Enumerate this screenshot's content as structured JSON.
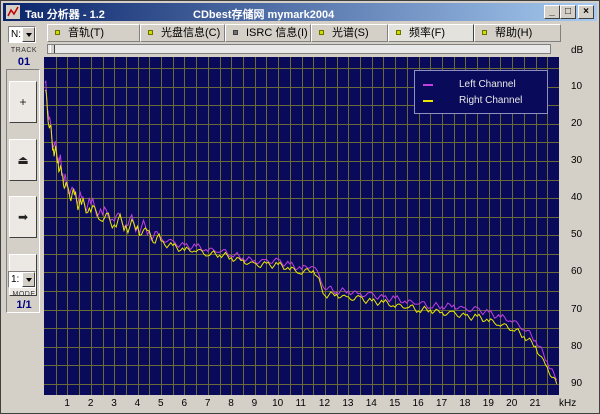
{
  "window": {
    "title": "Tau 分析器 - 1.2",
    "subtitle": "CDbest存储网 mymark2004",
    "buttons": [
      "_",
      "□",
      "×"
    ]
  },
  "tabs": [
    {
      "label": "音轨(T)",
      "marker": "yellow"
    },
    {
      "label": "光盘信息(C)",
      "marker": "yellow"
    },
    {
      "label": "ISRC 信息(I)",
      "marker": "gray"
    },
    {
      "label": "光谱(S)",
      "marker": "yellow"
    },
    {
      "label": "频率(F)",
      "marker": "yellow",
      "active": true
    },
    {
      "label": "帮助(H)",
      "marker": "yellow"
    }
  ],
  "left_panel": {
    "drive_combo": "N:",
    "track_label": "TRACK",
    "track_value": "01",
    "buttons": [
      {
        "icon": "plus-icon",
        "glyph": "+"
      },
      {
        "icon": "eject-icon",
        "glyph": "⏏"
      },
      {
        "icon": "play-icon",
        "glyph": "➡"
      },
      {
        "icon": "stop-icon",
        "glyph": "■"
      }
    ],
    "mode_combo": "1:",
    "mode_label": "MODE",
    "mode_value": "1/1"
  },
  "colors": {
    "plot_bg": "#0a0a5a",
    "grid": "#6a6a36",
    "left": "#c040e0",
    "right": "#e8e800"
  },
  "chart_data": {
    "type": "line",
    "title": "",
    "xlabel": "kHz",
    "ylabel": "dB",
    "xlim": [
      0,
      22
    ],
    "ylim": [
      -93,
      -2
    ],
    "x_ticks": [
      1,
      2,
      3,
      4,
      5,
      6,
      7,
      8,
      9,
      10,
      11,
      12,
      13,
      14,
      15,
      16,
      17,
      18,
      19,
      20,
      21
    ],
    "y_ticks": [
      -10,
      -20,
      -30,
      -40,
      -50,
      -60,
      -70,
      -80,
      -90
    ],
    "y_tick_labels": [
      "10",
      "20",
      "30",
      "40",
      "50",
      "60",
      "70",
      "80",
      "90"
    ],
    "grid": true,
    "legend": "top-right",
    "x": [
      0.05,
      0.2,
      0.4,
      0.6,
      0.8,
      1.0,
      1.3,
      1.6,
      2.0,
      2.5,
      3.0,
      3.5,
      4.0,
      4.5,
      5.0,
      5.5,
      6.0,
      6.5,
      7.0,
      7.5,
      8.0,
      8.5,
      9.0,
      9.5,
      10.0,
      10.5,
      11.0,
      11.5,
      12.0,
      12.5,
      13.0,
      13.5,
      14.0,
      14.5,
      15.0,
      15.5,
      16.0,
      16.5,
      17.0,
      17.5,
      18.0,
      18.5,
      19.0,
      19.5,
      20.0,
      20.5,
      21.0,
      21.5,
      21.9
    ],
    "series": [
      {
        "name": "Left Channel",
        "color": "#c040e0",
        "values": [
          -9,
          -18,
          -25,
          -28,
          -33,
          -37,
          -39,
          -41,
          -42,
          -44,
          -45,
          -46,
          -47,
          -49,
          -51,
          -52,
          -53,
          -53,
          -54,
          -54,
          -55,
          -56,
          -57,
          -57,
          -57,
          -58,
          -59,
          -58,
          -64,
          -65,
          -65,
          -66,
          -66,
          -67,
          -67,
          -68,
          -68,
          -69,
          -69,
          -69,
          -70,
          -70,
          -71,
          -72,
          -73,
          -75,
          -78,
          -84,
          -89
        ]
      },
      {
        "name": "Right Channel",
        "color": "#e8e800",
        "values": [
          -10,
          -19,
          -26,
          -30,
          -35,
          -38,
          -40,
          -42,
          -43,
          -45,
          -46,
          -47,
          -48,
          -50,
          -52,
          -53,
          -54,
          -54,
          -55,
          -55,
          -56,
          -57,
          -58,
          -58,
          -58,
          -59,
          -60,
          -59,
          -66,
          -66,
          -67,
          -67,
          -68,
          -68,
          -69,
          -69,
          -70,
          -70,
          -71,
          -71,
          -72,
          -72,
          -73,
          -74,
          -75,
          -77,
          -80,
          -86,
          -90
        ]
      }
    ]
  }
}
